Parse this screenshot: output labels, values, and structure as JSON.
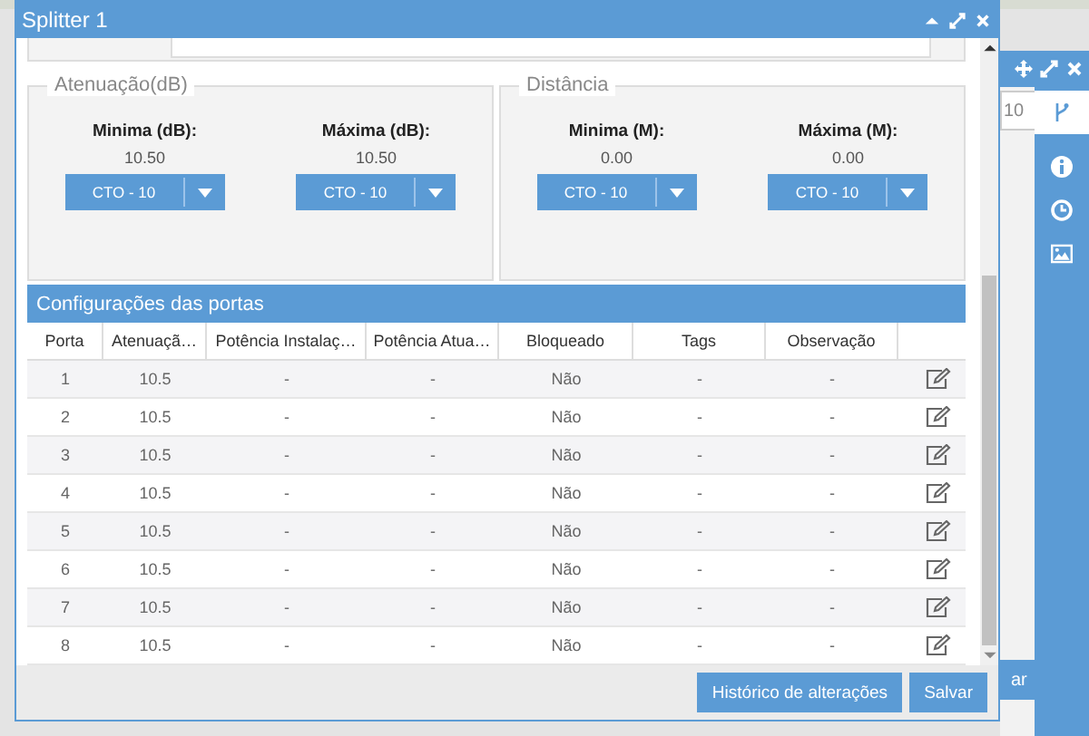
{
  "window": {
    "title": "Splitter 1"
  },
  "groups": [
    {
      "legend": "Atenuação(dB)",
      "fields": [
        {
          "label": "Minima (dB):",
          "value": "10.50",
          "select": "CTO - 10"
        },
        {
          "label": "Máxima (dB):",
          "value": "10.50",
          "select": "CTO - 10"
        }
      ]
    },
    {
      "legend": "Distância",
      "fields": [
        {
          "label": "Minima (M):",
          "value": "0.00",
          "select": "CTO - 10"
        },
        {
          "label": "Máxima (M):",
          "value": "0.00",
          "select": "CTO - 10"
        }
      ]
    }
  ],
  "ports": {
    "title": "Configurações das portas",
    "columns": [
      "Porta",
      "Atenuaçã…",
      "Potência Instalaç…",
      "Potência Atua…",
      "Bloqueado",
      "Tags",
      "Observação"
    ],
    "rows": [
      {
        "cells": [
          "1",
          "10.5",
          "-",
          "-",
          "Não",
          "-",
          "-"
        ]
      },
      {
        "cells": [
          "2",
          "10.5",
          "-",
          "-",
          "Não",
          "-",
          "-"
        ]
      },
      {
        "cells": [
          "3",
          "10.5",
          "-",
          "-",
          "Não",
          "-",
          "-"
        ]
      },
      {
        "cells": [
          "4",
          "10.5",
          "-",
          "-",
          "Não",
          "-",
          "-"
        ]
      },
      {
        "cells": [
          "5",
          "10.5",
          "-",
          "-",
          "Não",
          "-",
          "-"
        ]
      },
      {
        "cells": [
          "6",
          "10.5",
          "-",
          "-",
          "Não",
          "-",
          "-"
        ]
      },
      {
        "cells": [
          "7",
          "10.5",
          "-",
          "-",
          "Não",
          "-",
          "-"
        ]
      },
      {
        "cells": [
          "8",
          "10.5",
          "-",
          "-",
          "Não",
          "-",
          "-"
        ]
      }
    ]
  },
  "buttons": [
    "Histórico de alterações",
    "Salvar"
  ],
  "background": {
    "field_value": "10",
    "button_text": "ar"
  }
}
